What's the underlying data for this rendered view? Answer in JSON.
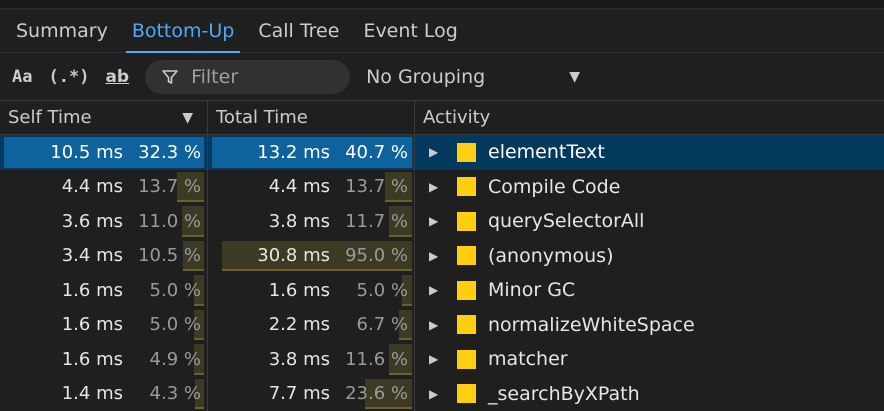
{
  "tabs": [
    {
      "label": "Summary"
    },
    {
      "label": "Bottom-Up"
    },
    {
      "label": "Call Tree"
    },
    {
      "label": "Event Log"
    }
  ],
  "active_tab": "Bottom-Up",
  "toolbar": {
    "match_case_label": "Aa",
    "regex_label": "(.*)",
    "whole_word_label": "ab",
    "filter_placeholder": "Filter",
    "grouping_value": "No Grouping"
  },
  "columns": {
    "self_time": "Self Time",
    "total_time": "Total Time",
    "activity": "Activity"
  },
  "colors": {
    "accent": "#4daafc",
    "activity_square": "#fecf11",
    "selected_row": "#04395e"
  },
  "rows": [
    {
      "self_ms": "10.5 ms",
      "self_pct": "32.3 %",
      "self_frac": 0.323,
      "total_ms": "13.2 ms",
      "total_pct": "40.7 %",
      "total_frac": 0.407,
      "activity": "elementText",
      "selected": true
    },
    {
      "self_ms": "4.4 ms",
      "self_pct": "13.7 %",
      "self_frac": 0.137,
      "total_ms": "4.4 ms",
      "total_pct": "13.7 %",
      "total_frac": 0.137,
      "activity": "Compile Code",
      "selected": false
    },
    {
      "self_ms": "3.6 ms",
      "self_pct": "11.0 %",
      "self_frac": 0.11,
      "total_ms": "3.8 ms",
      "total_pct": "11.7 %",
      "total_frac": 0.117,
      "activity": "querySelectorAll",
      "selected": false
    },
    {
      "self_ms": "3.4 ms",
      "self_pct": "10.5 %",
      "self_frac": 0.105,
      "total_ms": "30.8 ms",
      "total_pct": "95.0 %",
      "total_frac": 0.95,
      "activity": "(anonymous)",
      "selected": false
    },
    {
      "self_ms": "1.6 ms",
      "self_pct": "5.0 %",
      "self_frac": 0.05,
      "total_ms": "1.6 ms",
      "total_pct": "5.0 %",
      "total_frac": 0.05,
      "activity": "Minor GC",
      "selected": false
    },
    {
      "self_ms": "1.6 ms",
      "self_pct": "5.0 %",
      "self_frac": 0.05,
      "total_ms": "2.2 ms",
      "total_pct": "6.7 %",
      "total_frac": 0.067,
      "activity": "normalizeWhiteSpace",
      "selected": false
    },
    {
      "self_ms": "1.6 ms",
      "self_pct": "4.9 %",
      "self_frac": 0.049,
      "total_ms": "3.8 ms",
      "total_pct": "11.6 %",
      "total_frac": 0.116,
      "activity": "matcher",
      "selected": false
    },
    {
      "self_ms": "1.4 ms",
      "self_pct": "4.3 %",
      "self_frac": 0.043,
      "total_ms": "7.7 ms",
      "total_pct": "23.6 %",
      "total_frac": 0.236,
      "activity": "_searchByXPath",
      "selected": false
    }
  ]
}
